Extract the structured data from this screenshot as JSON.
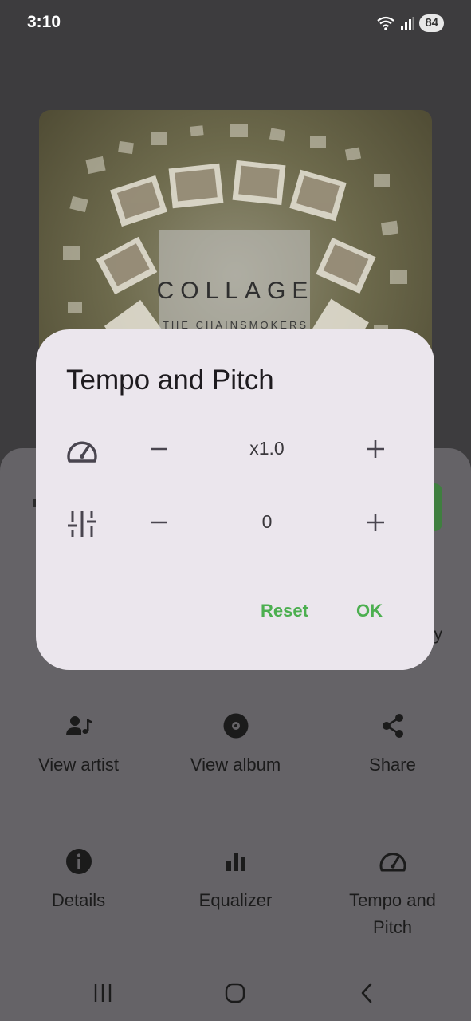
{
  "status_bar": {
    "time": "3:10",
    "battery": "84"
  },
  "album": {
    "title": "COLLAGE",
    "artist": "THE CHAINSMOKERS"
  },
  "dialog": {
    "title": "Tempo and Pitch",
    "tempo_value": "x1.0",
    "pitch_value": "0",
    "reset_label": "Reset",
    "ok_label": "OK"
  },
  "actions": [
    {
      "label": "View artist",
      "icon": "person-music-icon"
    },
    {
      "label": "View album",
      "icon": "disc-icon"
    },
    {
      "label": "Share",
      "icon": "share-icon"
    },
    {
      "label": "Details",
      "icon": "info-icon"
    },
    {
      "label": "Equalizer",
      "icon": "equalizer-icon"
    },
    {
      "label": "Tempo and Pitch",
      "icon": "speedometer-icon"
    }
  ],
  "colors": {
    "accent": "#4caf50",
    "dialog_bg": "#ebe6ed",
    "scrim": "#656367"
  }
}
